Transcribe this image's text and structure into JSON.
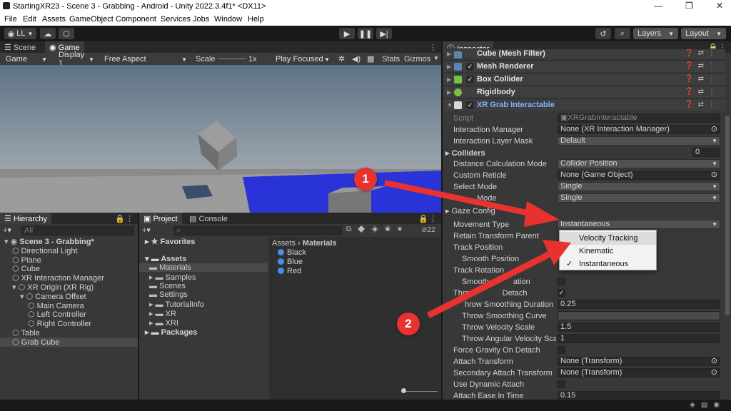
{
  "window": {
    "title": "StartingXR23 - Scene 3 - Grabbing - Android - Unity 2022.3.4f1* <DX11>",
    "controls": [
      "—",
      "❐",
      "✕"
    ]
  },
  "menu": [
    "File",
    "Edit",
    "Assets",
    "GameObject",
    "Component",
    "Services",
    "Jobs",
    "Window",
    "Help"
  ],
  "toolbar": {
    "account": "LL",
    "layers": "Layers",
    "layout": "Layout"
  },
  "scene_tabs": {
    "scene": "Scene",
    "game": "Game"
  },
  "game_bar": {
    "mode": "Game",
    "display": "Display 1",
    "aspect": "Free Aspect",
    "scale_label": "Scale",
    "scale_value": "1x",
    "play_mode": "Play Focused",
    "stats": "Stats",
    "gizmos": "Gizmos"
  },
  "hierarchy": {
    "tab": "Hierarchy",
    "search_placeholder": "All",
    "items": [
      {
        "label": "Scene 3 - Grabbing*",
        "indent": 0
      },
      {
        "label": "Directional Light",
        "indent": 1
      },
      {
        "label": "Plane",
        "indent": 1
      },
      {
        "label": "Cube",
        "indent": 1
      },
      {
        "label": "XR Interaction Manager",
        "indent": 1
      },
      {
        "label": "XR Origin (XR Rig)",
        "indent": 1
      },
      {
        "label": "Camera Offset",
        "indent": 2
      },
      {
        "label": "Main Camera",
        "indent": 3
      },
      {
        "label": "Left Controller",
        "indent": 3
      },
      {
        "label": "Right Controller",
        "indent": 3
      },
      {
        "label": "Table",
        "indent": 1
      },
      {
        "label": "Grab Cube",
        "indent": 1
      }
    ]
  },
  "project": {
    "tab_project": "Project",
    "tab_console": "Console",
    "hidden_count": "22",
    "favorites": "Favorites",
    "assets": "Assets",
    "folders": [
      "Materials",
      "Samples",
      "Scenes",
      "Settings",
      "TutorialInfo",
      "XR",
      "XRI"
    ],
    "packages": "Packages",
    "breadcrumb_root": "Assets",
    "breadcrumb_current": "Materials",
    "materials": [
      {
        "name": "Black",
        "color": "#4a8fe0"
      },
      {
        "name": "Blue",
        "color": "#4a8fe0"
      },
      {
        "name": "Red",
        "color": "#4a8fe0"
      }
    ]
  },
  "inspector": {
    "tab": "Inspector",
    "components": [
      {
        "label": "Cube (Mesh Filter)",
        "icon": "grid-icon"
      },
      {
        "label": "Mesh Renderer",
        "icon": "grid-icon"
      },
      {
        "label": "Box Collider",
        "icon": "cube-icon"
      },
      {
        "label": "Rigidbody",
        "icon": "sphere-icon"
      },
      {
        "label": "XR Grab Interactable",
        "icon": "script-icon"
      }
    ],
    "fields": {
      "script_label": "Script",
      "script_value": "XRGrabInteractable",
      "interaction_manager_label": "Interaction Manager",
      "interaction_manager_value": "None (XR Interaction Manager)",
      "interaction_layer_label": "Interaction Layer Mask",
      "interaction_layer_value": "Default",
      "colliders_label": "Colliders",
      "colliders_value": "0",
      "distance_label": "Distance Calculation Mode",
      "distance_value": "Collider Position",
      "reticle_label": "Custom Reticle",
      "reticle_value": "None (Game Object)",
      "select_label": "Select Mode",
      "select_value": "Single",
      "focus_label": "Mode",
      "focus_value": "Single",
      "gaze_label": "Gaze Config",
      "movement_label": "Movement Type",
      "movement_value": "Instantaneous",
      "retain_label": "Retain Transform Parent",
      "track_pos_label": "Track Position",
      "smooth_pos_label": "Smooth Position",
      "track_rot_label": "Track Rotation",
      "smooth_rot_label": "Smooth",
      "smooth_rot_label_tail": "ation",
      "throw_label": "Thro",
      "throw_label_tail": "Detach",
      "throw_dur_label": "hrow Smoothing Duration",
      "throw_dur_value": "0.25",
      "throw_curve_label": "Throw Smoothing Curve",
      "throw_vel_label": "Throw Velocity Scale",
      "throw_vel_value": "1.5",
      "throw_ang_label": "Throw Angular Velocity Scal",
      "throw_ang_value": "1",
      "gravity_label": "Force Gravity On Detach",
      "attach_label": "Attach Transform",
      "attach_value": "None (Transform)",
      "sec_attach_label": "Secondary Attach Transform",
      "sec_attach_value": "None (Transform)",
      "dyn_attach_label": "Use Dynamic Attach",
      "ease_label": "Attach Ease In Time",
      "ease_value": "0.15"
    },
    "dropdown_options": [
      "Velocity Tracking",
      "Kinematic",
      "Instantaneous"
    ]
  },
  "annotations": {
    "one": "1",
    "two": "2",
    "color": "#e8322f"
  }
}
